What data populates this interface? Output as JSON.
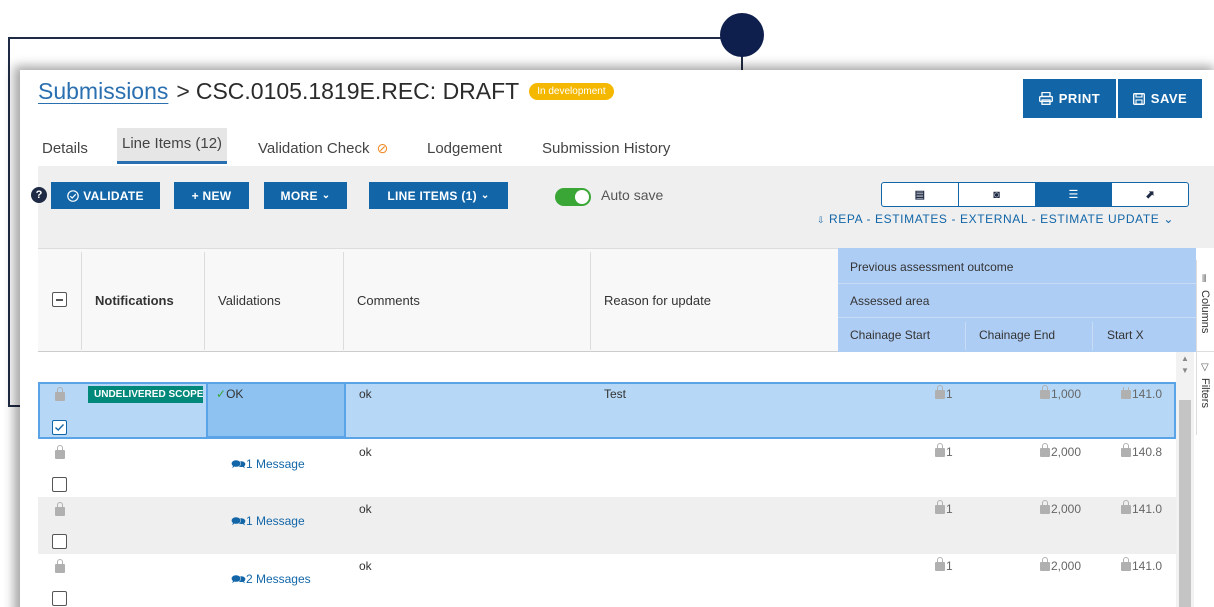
{
  "breadcrumb": {
    "parent": "Submissions",
    "separator": ">",
    "current": "CSC.0105.1819E.REC: DRAFT",
    "status_badge": "In development"
  },
  "actions": {
    "print": "PRINT",
    "save": "SAVE"
  },
  "tabs": [
    {
      "label": "Details"
    },
    {
      "label": "Line Items (12)"
    },
    {
      "label": "Validation Check"
    },
    {
      "label": "Lodgement"
    },
    {
      "label": "Submission History"
    }
  ],
  "toolbar": {
    "help": "?",
    "validate": "VALIDATE",
    "new": "+ NEW",
    "more": "MORE",
    "line_items": "LINE ITEMS (1)",
    "auto_save_label": "Auto save",
    "auto_save_on": true,
    "view_name": "REPA - ESTIMATES - EXTERNAL - ESTIMATE UPDATE"
  },
  "grid": {
    "headers": {
      "notifications": "Notifications",
      "validations": "Validations",
      "comments": "Comments",
      "reason": "Reason for update",
      "group1": "Previous assessment outcome",
      "group2": "Assessed area",
      "chainage_start": "Chainage Start",
      "chainage_end": "Chainage End",
      "start_x": "Start X"
    },
    "rows": [
      {
        "tag": "UNDELIVERED SCOPE",
        "validation": "OK",
        "comment": "ok",
        "reason": "Test",
        "chainage_start": "1",
        "chainage_end": "1,000",
        "start_x": "141.0",
        "checked": true
      },
      {
        "tag": "",
        "validation": "1 Message",
        "comment": "ok",
        "reason": "",
        "chainage_start": "1",
        "chainage_end": "2,000",
        "start_x": "140.8",
        "checked": false
      },
      {
        "tag": "",
        "validation": "1 Message",
        "comment": "ok",
        "reason": "",
        "chainage_start": "1",
        "chainage_end": "2,000",
        "start_x": "141.0",
        "checked": false
      },
      {
        "tag": "",
        "validation": "2 Messages",
        "comment": "ok",
        "reason": "",
        "chainage_start": "1",
        "chainage_end": "2,000",
        "start_x": "141.0",
        "checked": false
      }
    ]
  },
  "side_panel": {
    "columns": "Columns",
    "filters": "Filters"
  },
  "colors": {
    "primary": "#1266a8",
    "badge": "#f5b800",
    "tag": "#00897b",
    "selected_row": "#b6d8f6",
    "header_blue": "#aecdf5",
    "toggle": "#3aa635"
  }
}
